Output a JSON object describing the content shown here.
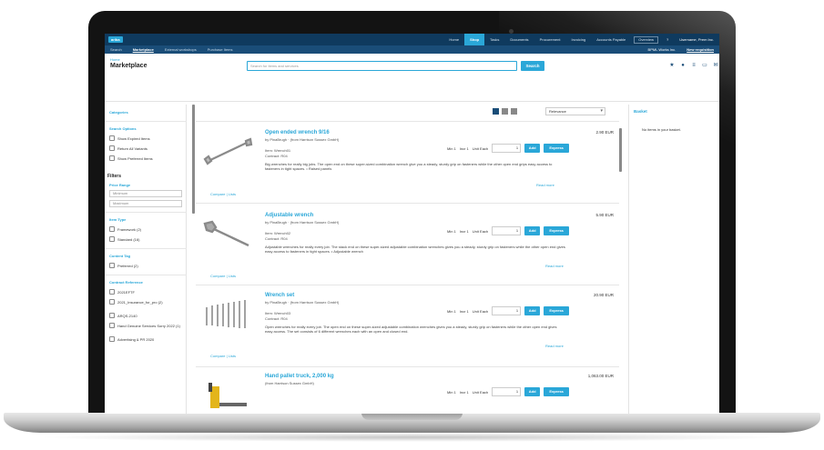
{
  "app": {
    "logo": "ariba",
    "modules": [
      "Home",
      "Shop",
      "Tasks",
      "Documents",
      "Procurement",
      "Invoicing",
      "Accounts Payable"
    ],
    "active_module": "Shop",
    "module_button": "Overview",
    "user": "Username, Prem Inc."
  },
  "subnav": {
    "items": [
      "Search",
      "Marketplace",
      "External workshops",
      "Purchase Items"
    ],
    "active": "Marketplace",
    "right_company": "BPML Works Inc.",
    "right_link": "New requisition"
  },
  "breadcrumb": "Home",
  "page_title": "Marketplace",
  "search": {
    "placeholder": "Search for items and services",
    "button": "Search"
  },
  "tools": [
    "star-icon",
    "person-icon",
    "list-icon",
    "print-icon",
    "mail-icon"
  ],
  "filters": {
    "categories": "Categories",
    "search_options": {
      "label": "Search Options",
      "items": [
        "Show Expired Items",
        "Return All Variants",
        "Show Preferred Items"
      ]
    },
    "filters_heading": "Filters",
    "price_range": {
      "label": "Price Range",
      "min_placeholder": "Minimum",
      "max_placeholder": "Maximum"
    },
    "item_type": {
      "label": "Item Type",
      "items": [
        "Framework (2)",
        "Standard (16)"
      ]
    },
    "content_tag": {
      "label": "Content Tag",
      "items": [
        "Preferred (2)"
      ]
    },
    "contract_reference": {
      "label": "Contract Reference",
      "items": [
        "2021EFTF",
        "2021_Insurance_for_pro (2)",
        "ARQS-2140",
        "Hand Genuine Services Sorry 2022 (1)",
        "Advertising & PR 2020"
      ]
    }
  },
  "results": {
    "sort_value": "Relevance",
    "compare_label": "Compare",
    "lists_label": "Lists",
    "read_more": "Read more",
    "add_label": "Add",
    "express_label": "Express",
    "unit_label": "Unit Each",
    "items": [
      {
        "name": "Open ended wrench 9/16",
        "by": "by PinaBrugh · (from Harrison Sussex GmbH)",
        "meta1": "Item: Wrench01",
        "meta2": "Contract: R04",
        "desc": "Big wrenches for really big jobs. The open end on these super-sized combination wrench give you a steady, sturdy grip on fasteners while the other open end grips easy access to fasteners in tight spaces. • Raised panels",
        "price": "2.90 EUR",
        "min": "Min 1",
        "incr": "Incr 1",
        "qty": "1"
      },
      {
        "name": "Adjustable wrench",
        "by": "by PinaBrugh · (from Harrison Sussex GmbH)",
        "meta1": "Item: Wrench02",
        "meta2": "Contract: R04",
        "desc": "Adjustable wrenches for really every job. The stack end on these super-sized adjustable combination wrenches gives you a steady, sturdy grip on fasteners while the other open end gives easy access to fasteners in tight spaces. • Adjustable wrench",
        "price": "5.90 EUR",
        "min": "Min 1",
        "incr": "Incr 1",
        "qty": "1"
      },
      {
        "name": "Wrench set",
        "by": "by PinaBrugh · (from Harrison Sussex GmbH)",
        "meta1": "Item: Wrench03",
        "meta2": "Contract: R04",
        "desc": "Open wrenches for really every job. The open end on these super-sized adjustable combination wrenches gives you a steady, sturdy grip on fasteners while the other open end gives easy access. The set consists of 6 different wrenches each with an open and closed end.",
        "price": "20.90 EUR",
        "min": "Min 1",
        "incr": "Incr 1",
        "qty": "1"
      },
      {
        "name": "Hand pallet truck, 2,000 kg",
        "by": "(from Harrison Sussex GmbH)",
        "meta1": "",
        "meta2": "",
        "desc": "",
        "price": "1,063.00 EUR",
        "min": "Min 1",
        "incr": "Incr 1",
        "qty": "1"
      }
    ]
  },
  "basket": {
    "title": "Basket",
    "empty": "No items in your basket."
  },
  "colors": {
    "primary": "#2aa7d8",
    "navy": "#0f3a5e",
    "subnav": "#1a4d78"
  }
}
